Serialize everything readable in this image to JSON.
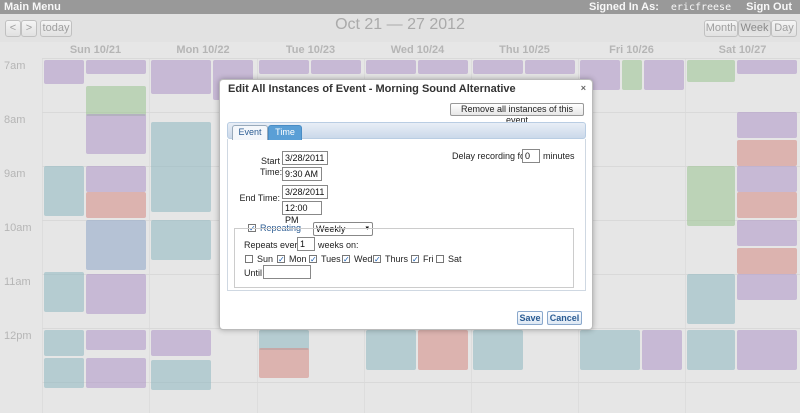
{
  "topbar": {
    "main_menu": "Main Menu",
    "signed_in_label": "Signed In As:",
    "signed_in_user": "ericfreese",
    "sign_out": "Sign Out"
  },
  "toolbar": {
    "prev": "<",
    "next": ">",
    "today": "today",
    "title": "Oct 21 — 27 2012",
    "views": [
      "Month",
      "Week",
      "Day"
    ],
    "active_view": "Week"
  },
  "calendar": {
    "days": [
      "Sun 10/21",
      "Mon 10/22",
      "Tue 10/23",
      "Wed 10/24",
      "Thu 10/25",
      "Fri 10/26",
      "Sat 10/27"
    ],
    "hours": [
      "7am",
      "8am",
      "9am",
      "10am",
      "11am",
      "12pm"
    ],
    "colors": {
      "purple": "#8d66b4",
      "green": "#6fae5f",
      "red": "#c8544a",
      "teal": "#5a9aa8",
      "blue": "#5a7fb4"
    }
  },
  "dialog": {
    "title": "Edit All Instances of Event - Morning Sound Alternative",
    "close": "×",
    "remove_button": "Remove all instances of this event",
    "tabs": [
      "Event",
      "Time"
    ],
    "active_tab": "Time",
    "start_label": "Start Time:",
    "start_date": "3/28/2011",
    "start_time": "9:30 AM",
    "end_label": "End Time:",
    "end_date": "3/28/2011",
    "end_time": "12:00 PM",
    "delay_label": "Delay recording for",
    "delay_value": "0",
    "delay_unit": "minutes",
    "repeating_label": "Repeating",
    "repeating_checked": true,
    "frequency": "Weekly",
    "repeats_every_label": "Repeats every",
    "repeats_every_value": "1",
    "weeks_on_label": "weeks on:",
    "weekdays": [
      {
        "label": "Sun",
        "checked": false
      },
      {
        "label": "Mon",
        "checked": true
      },
      {
        "label": "Tues",
        "checked": true
      },
      {
        "label": "Wed",
        "checked": true
      },
      {
        "label": "Thurs",
        "checked": true
      },
      {
        "label": "Fri",
        "checked": true
      },
      {
        "label": "Sat",
        "checked": false
      }
    ],
    "until_label": "Until",
    "until_value": "",
    "save": "Save",
    "cancel": "Cancel"
  }
}
